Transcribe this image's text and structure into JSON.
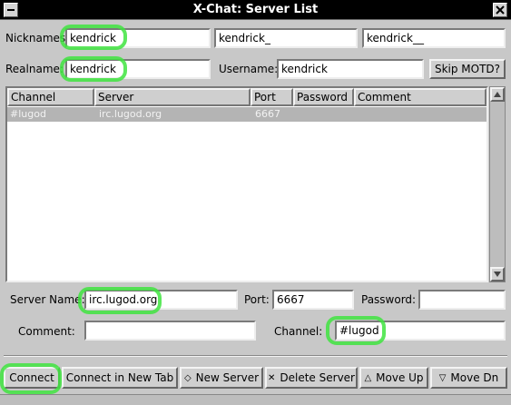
{
  "window": {
    "title": "X-Chat: Server List"
  },
  "form": {
    "nicknames_label": "Nicknames:",
    "nick1": "kendrick",
    "nick2": "kendrick_",
    "nick3": "kendrick__",
    "realname_label": "Realname:",
    "realname": "kendrick",
    "username_label": "Username:",
    "username": "kendrick",
    "skip_motd_label": "Skip MOTD?"
  },
  "server_list": {
    "columns": [
      "Channel",
      "Server",
      "Port",
      "Password",
      "Comment"
    ],
    "rows": [
      {
        "channel": "#lugod",
        "server": "irc.lugod.org",
        "port": "6667",
        "password": "",
        "comment": ""
      }
    ]
  },
  "details": {
    "server_name_label": "Server Name:",
    "server_name": "irc.lugod.org",
    "port_label": "Port:",
    "port": "6667",
    "password_label": "Password:",
    "password": "",
    "comment_label": "Comment:",
    "comment": "",
    "channel_label": "Channel:",
    "channel": "#lugod"
  },
  "buttons": {
    "connect": "Connect",
    "connect_new_tab": "Connect in New Tab",
    "new_server": "New Server",
    "delete_server": "Delete Server",
    "move_up": "Move Up",
    "move_down": "Move Dn"
  },
  "icons": {
    "new_server": "diamond-icon",
    "delete_server": "x-icon",
    "move_up": "triangle-up-icon",
    "move_down": "triangle-down-icon"
  },
  "colors": {
    "highlight": "#3fe43f",
    "titlebar": "#000000",
    "selected_row": "#b4b4b4"
  }
}
